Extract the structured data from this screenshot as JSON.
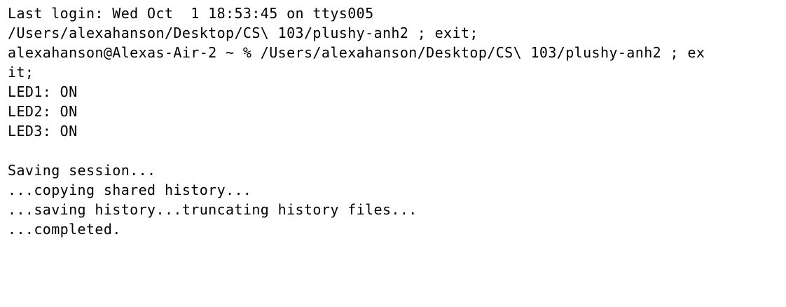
{
  "terminal": {
    "lines": [
      "Last login: Wed Oct  1 18:53:45 on ttys005",
      "/Users/alexahanson/Desktop/CS\\ 103/plushy-anh2 ; exit;",
      "alexahanson@Alexas-Air-2 ~ % /Users/alexahanson/Desktop/CS\\ 103/plushy-anh2 ; ex",
      "it;",
      "LED1: ON",
      "LED2: ON",
      "LED3: ON",
      "",
      "Saving session...",
      "...copying shared history...",
      "...saving history...truncating history files...",
      "...completed."
    ]
  },
  "colors": {
    "background": "#ffffff",
    "text": "#000000",
    "cursor": "#9a9a9a"
  }
}
